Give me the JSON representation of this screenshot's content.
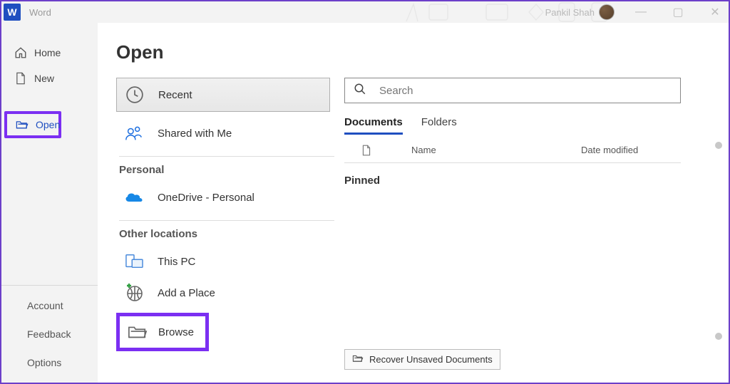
{
  "app": {
    "title": "Word"
  },
  "user": {
    "name": "Pankil Shah"
  },
  "window": {
    "minimize": "—",
    "maximize": "▢",
    "close": "✕"
  },
  "nav": {
    "home": "Home",
    "new": "New",
    "open": "Open",
    "account": "Account",
    "feedback": "Feedback",
    "options": "Options"
  },
  "page": {
    "title": "Open"
  },
  "locations": {
    "recent": "Recent",
    "shared": "Shared with Me",
    "personal_header": "Personal",
    "onedrive": "OneDrive - Personal",
    "other_header": "Other locations",
    "thispc": "This PC",
    "addplace": "Add a Place",
    "browse": "Browse"
  },
  "search": {
    "placeholder": "Search"
  },
  "tabs": {
    "documents": "Documents",
    "folders": "Folders"
  },
  "list": {
    "col_name": "Name",
    "col_date": "Date modified",
    "pinned": "Pinned"
  },
  "recover": {
    "label": "Recover Unsaved Documents"
  }
}
